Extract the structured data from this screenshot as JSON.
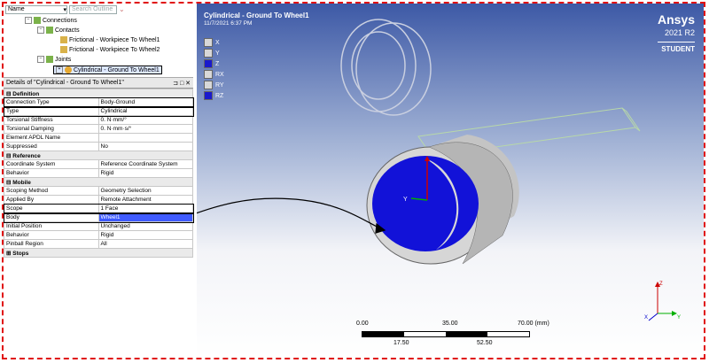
{
  "tree_header": {
    "name_label": "Name",
    "search_placeholder": "Search Outline"
  },
  "tree": {
    "connections": "Connections",
    "contacts": "Contacts",
    "contact1": "Frictional - Workpiece To Wheel1",
    "contact2": "Frictional - Workpiece To Wheel2",
    "joints": "Joints",
    "joint1": "Cylindrical - Ground To Wheel1"
  },
  "details": {
    "title": "Details of \"Cylindrical - Ground To Wheel1\"",
    "definition": "Definition",
    "rows_def": [
      {
        "k": "Connection Type",
        "v": "Body-Ground"
      },
      {
        "k": "Type",
        "v": "Cylindrical"
      },
      {
        "k": "Torsional Stiffness",
        "v": "0. N·mm/°"
      },
      {
        "k": "Torsional Damping",
        "v": "0. N·mm·s/°"
      },
      {
        "k": "Element APDL Name",
        "v": ""
      },
      {
        "k": "Suppressed",
        "v": "No"
      }
    ],
    "reference": "Reference",
    "rows_ref": [
      {
        "k": "Coordinate System",
        "v": "Reference Coordinate System"
      },
      {
        "k": "Behavior",
        "v": "Rigid"
      }
    ],
    "mobile": "Mobile",
    "rows_mob": [
      {
        "k": "Scoping Method",
        "v": "Geometry Selection"
      },
      {
        "k": "Applied By",
        "v": "Remote Attachment"
      },
      {
        "k": "Scope",
        "v": "1 Face"
      },
      {
        "k": "Body",
        "v": "Wheel1"
      },
      {
        "k": "Initial Position",
        "v": "Unchanged"
      },
      {
        "k": "Behavior",
        "v": "Rigid"
      },
      {
        "k": "Pinball Region",
        "v": "All"
      }
    ],
    "stops": "Stops"
  },
  "viewport": {
    "title": "Cylindrical - Ground To Wheel1",
    "date": "11/7/2021 6:37 PM",
    "brand": "Ansys",
    "version": "2021 R2",
    "edition": "STUDENT",
    "legend": [
      {
        "label": "X",
        "color": "#d8d8d8"
      },
      {
        "label": "Y",
        "color": "#d8d8d8"
      },
      {
        "label": "Z",
        "color": "#1a1acc"
      },
      {
        "label": "RX",
        "color": "#d8d8d8"
      },
      {
        "label": "RY",
        "color": "#d8d8d8"
      },
      {
        "label": "RZ",
        "color": "#1a1acc"
      }
    ],
    "scale_top": [
      "0.00",
      "35.00",
      "70.00 (mm)"
    ],
    "scale_bottom": [
      "17.50",
      "52.50"
    ]
  },
  "colors": {
    "highlight": "#3f5bff",
    "annotation_frame": "#e01010",
    "face": "#1212d8"
  }
}
